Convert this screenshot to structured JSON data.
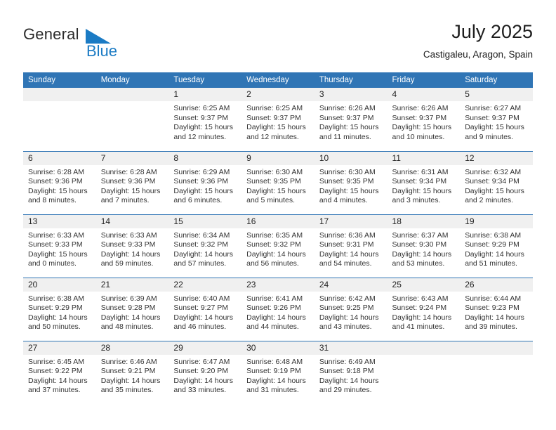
{
  "brand": {
    "line1": "General",
    "line2": "Blue",
    "triangle_icon": "brand-triangle-icon",
    "accent_color": "#1b7bc4"
  },
  "header": {
    "title": "July 2025",
    "subtitle": "Castigaleu, Aragon, Spain"
  },
  "colors": {
    "header_blue": "#3075b5",
    "day_band_gray": "#f0f0f0",
    "text": "#333333"
  },
  "weekday_headers": [
    "Sunday",
    "Monday",
    "Tuesday",
    "Wednesday",
    "Thursday",
    "Friday",
    "Saturday"
  ],
  "weeks": [
    [
      {
        "day": "",
        "empty": true,
        "sunrise": "",
        "sunset": "",
        "daylight": ""
      },
      {
        "day": "",
        "empty": true,
        "sunrise": "",
        "sunset": "",
        "daylight": ""
      },
      {
        "day": "1",
        "sunrise": "Sunrise: 6:25 AM",
        "sunset": "Sunset: 9:37 PM",
        "daylight": "Daylight: 15 hours and 12 minutes."
      },
      {
        "day": "2",
        "sunrise": "Sunrise: 6:25 AM",
        "sunset": "Sunset: 9:37 PM",
        "daylight": "Daylight: 15 hours and 12 minutes."
      },
      {
        "day": "3",
        "sunrise": "Sunrise: 6:26 AM",
        "sunset": "Sunset: 9:37 PM",
        "daylight": "Daylight: 15 hours and 11 minutes."
      },
      {
        "day": "4",
        "sunrise": "Sunrise: 6:26 AM",
        "sunset": "Sunset: 9:37 PM",
        "daylight": "Daylight: 15 hours and 10 minutes."
      },
      {
        "day": "5",
        "sunrise": "Sunrise: 6:27 AM",
        "sunset": "Sunset: 9:37 PM",
        "daylight": "Daylight: 15 hours and 9 minutes."
      }
    ],
    [
      {
        "day": "6",
        "sunrise": "Sunrise: 6:28 AM",
        "sunset": "Sunset: 9:36 PM",
        "daylight": "Daylight: 15 hours and 8 minutes."
      },
      {
        "day": "7",
        "sunrise": "Sunrise: 6:28 AM",
        "sunset": "Sunset: 9:36 PM",
        "daylight": "Daylight: 15 hours and 7 minutes."
      },
      {
        "day": "8",
        "sunrise": "Sunrise: 6:29 AM",
        "sunset": "Sunset: 9:36 PM",
        "daylight": "Daylight: 15 hours and 6 minutes."
      },
      {
        "day": "9",
        "sunrise": "Sunrise: 6:30 AM",
        "sunset": "Sunset: 9:35 PM",
        "daylight": "Daylight: 15 hours and 5 minutes."
      },
      {
        "day": "10",
        "sunrise": "Sunrise: 6:30 AM",
        "sunset": "Sunset: 9:35 PM",
        "daylight": "Daylight: 15 hours and 4 minutes."
      },
      {
        "day": "11",
        "sunrise": "Sunrise: 6:31 AM",
        "sunset": "Sunset: 9:34 PM",
        "daylight": "Daylight: 15 hours and 3 minutes."
      },
      {
        "day": "12",
        "sunrise": "Sunrise: 6:32 AM",
        "sunset": "Sunset: 9:34 PM",
        "daylight": "Daylight: 15 hours and 2 minutes."
      }
    ],
    [
      {
        "day": "13",
        "sunrise": "Sunrise: 6:33 AM",
        "sunset": "Sunset: 9:33 PM",
        "daylight": "Daylight: 15 hours and 0 minutes."
      },
      {
        "day": "14",
        "sunrise": "Sunrise: 6:33 AM",
        "sunset": "Sunset: 9:33 PM",
        "daylight": "Daylight: 14 hours and 59 minutes."
      },
      {
        "day": "15",
        "sunrise": "Sunrise: 6:34 AM",
        "sunset": "Sunset: 9:32 PM",
        "daylight": "Daylight: 14 hours and 57 minutes."
      },
      {
        "day": "16",
        "sunrise": "Sunrise: 6:35 AM",
        "sunset": "Sunset: 9:32 PM",
        "daylight": "Daylight: 14 hours and 56 minutes."
      },
      {
        "day": "17",
        "sunrise": "Sunrise: 6:36 AM",
        "sunset": "Sunset: 9:31 PM",
        "daylight": "Daylight: 14 hours and 54 minutes."
      },
      {
        "day": "18",
        "sunrise": "Sunrise: 6:37 AM",
        "sunset": "Sunset: 9:30 PM",
        "daylight": "Daylight: 14 hours and 53 minutes."
      },
      {
        "day": "19",
        "sunrise": "Sunrise: 6:38 AM",
        "sunset": "Sunset: 9:29 PM",
        "daylight": "Daylight: 14 hours and 51 minutes."
      }
    ],
    [
      {
        "day": "20",
        "sunrise": "Sunrise: 6:38 AM",
        "sunset": "Sunset: 9:29 PM",
        "daylight": "Daylight: 14 hours and 50 minutes."
      },
      {
        "day": "21",
        "sunrise": "Sunrise: 6:39 AM",
        "sunset": "Sunset: 9:28 PM",
        "daylight": "Daylight: 14 hours and 48 minutes."
      },
      {
        "day": "22",
        "sunrise": "Sunrise: 6:40 AM",
        "sunset": "Sunset: 9:27 PM",
        "daylight": "Daylight: 14 hours and 46 minutes."
      },
      {
        "day": "23",
        "sunrise": "Sunrise: 6:41 AM",
        "sunset": "Sunset: 9:26 PM",
        "daylight": "Daylight: 14 hours and 44 minutes."
      },
      {
        "day": "24",
        "sunrise": "Sunrise: 6:42 AM",
        "sunset": "Sunset: 9:25 PM",
        "daylight": "Daylight: 14 hours and 43 minutes."
      },
      {
        "day": "25",
        "sunrise": "Sunrise: 6:43 AM",
        "sunset": "Sunset: 9:24 PM",
        "daylight": "Daylight: 14 hours and 41 minutes."
      },
      {
        "day": "26",
        "sunrise": "Sunrise: 6:44 AM",
        "sunset": "Sunset: 9:23 PM",
        "daylight": "Daylight: 14 hours and 39 minutes."
      }
    ],
    [
      {
        "day": "27",
        "sunrise": "Sunrise: 6:45 AM",
        "sunset": "Sunset: 9:22 PM",
        "daylight": "Daylight: 14 hours and 37 minutes."
      },
      {
        "day": "28",
        "sunrise": "Sunrise: 6:46 AM",
        "sunset": "Sunset: 9:21 PM",
        "daylight": "Daylight: 14 hours and 35 minutes."
      },
      {
        "day": "29",
        "sunrise": "Sunrise: 6:47 AM",
        "sunset": "Sunset: 9:20 PM",
        "daylight": "Daylight: 14 hours and 33 minutes."
      },
      {
        "day": "30",
        "sunrise": "Sunrise: 6:48 AM",
        "sunset": "Sunset: 9:19 PM",
        "daylight": "Daylight: 14 hours and 31 minutes."
      },
      {
        "day": "31",
        "sunrise": "Sunrise: 6:49 AM",
        "sunset": "Sunset: 9:18 PM",
        "daylight": "Daylight: 14 hours and 29 minutes."
      },
      {
        "day": "",
        "empty": true,
        "sunrise": "",
        "sunset": "",
        "daylight": ""
      },
      {
        "day": "",
        "empty": true,
        "sunrise": "",
        "sunset": "",
        "daylight": ""
      }
    ]
  ]
}
